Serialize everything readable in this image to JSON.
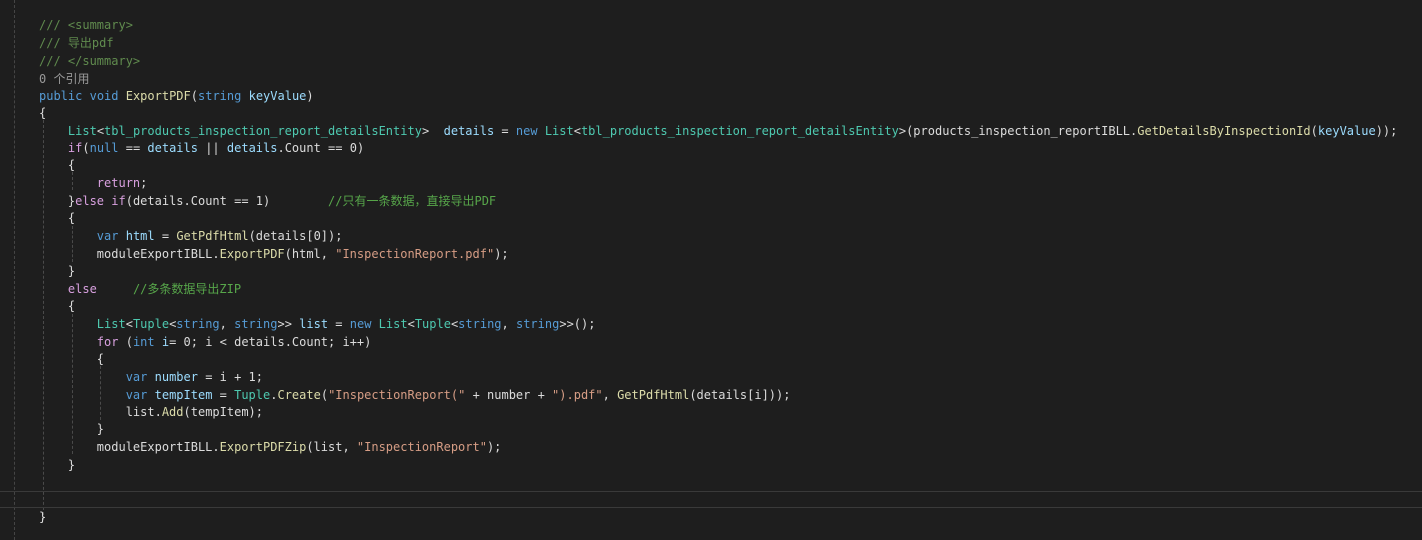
{
  "editor": {
    "colors": {
      "background": "#1e1e1e",
      "text": "#dcdcdc",
      "comment": "#57a64a",
      "keyword": "#569cd6",
      "control_keyword": "#d8a0df",
      "type": "#4ec9b0",
      "method": "#dcdcaa",
      "variable": "#9cdcfe",
      "string": "#d69d85"
    },
    "lines": [
      {
        "tokens": [
          {
            "t": "/// <summary>",
            "c": "d"
          }
        ]
      },
      {
        "tokens": [
          {
            "t": "/// 导出pdf",
            "c": "d"
          }
        ]
      },
      {
        "tokens": [
          {
            "t": "/// </summary>",
            "c": "d"
          }
        ]
      },
      {
        "tokens": [
          {
            "t": "0 个引用",
            "c": "g"
          }
        ]
      },
      {
        "tokens": [
          {
            "t": "public",
            "c": "k"
          },
          {
            "t": " "
          },
          {
            "t": "void",
            "c": "k"
          },
          {
            "t": " "
          },
          {
            "t": "ExportPDF",
            "c": "m"
          },
          {
            "t": "("
          },
          {
            "t": "string",
            "c": "k"
          },
          {
            "t": " "
          },
          {
            "t": "keyValue",
            "c": "v"
          },
          {
            "t": ")"
          }
        ]
      },
      {
        "tokens": [
          {
            "t": "{"
          }
        ]
      },
      {
        "tokens": [
          {
            "t": "    "
          },
          {
            "t": "List",
            "c": "t"
          },
          {
            "t": "<"
          },
          {
            "t": "tbl_products_inspection_report_detailsEntity",
            "c": "t"
          },
          {
            "t": ">  "
          },
          {
            "t": "details",
            "c": "v"
          },
          {
            "t": " = "
          },
          {
            "t": "new",
            "c": "k"
          },
          {
            "t": " "
          },
          {
            "t": "List",
            "c": "t"
          },
          {
            "t": "<"
          },
          {
            "t": "tbl_products_inspection_report_detailsEntity",
            "c": "t"
          },
          {
            "t": ">(products_inspection_reportIBLL."
          },
          {
            "t": "GetDetailsByInspectionId",
            "c": "m"
          },
          {
            "t": "("
          },
          {
            "t": "keyValue",
            "c": "v"
          },
          {
            "t": "));"
          }
        ]
      },
      {
        "tokens": [
          {
            "t": "    "
          },
          {
            "t": "if",
            "c": "k2"
          },
          {
            "t": "("
          },
          {
            "t": "null",
            "c": "k"
          },
          {
            "t": " == "
          },
          {
            "t": "details",
            "c": "v"
          },
          {
            "t": " || "
          },
          {
            "t": "details",
            "c": "v"
          },
          {
            "t": ".Count == 0)"
          }
        ]
      },
      {
        "tokens": [
          {
            "t": "    {"
          }
        ]
      },
      {
        "tokens": [
          {
            "t": "        "
          },
          {
            "t": "return",
            "c": "k2"
          },
          {
            "t": ";"
          }
        ]
      },
      {
        "tokens": [
          {
            "t": "    }"
          },
          {
            "t": "else",
            "c": "k2"
          },
          {
            "t": " "
          },
          {
            "t": "if",
            "c": "k2"
          },
          {
            "t": "(details.Count == 1)        "
          },
          {
            "t": "//只有一条数据，直接导出PDF",
            "c": "c"
          }
        ]
      },
      {
        "tokens": [
          {
            "t": "    {"
          }
        ]
      },
      {
        "tokens": [
          {
            "t": "        "
          },
          {
            "t": "var",
            "c": "k"
          },
          {
            "t": " "
          },
          {
            "t": "html",
            "c": "v"
          },
          {
            "t": " = "
          },
          {
            "t": "GetPdfHtml",
            "c": "m"
          },
          {
            "t": "(details[0]);"
          }
        ]
      },
      {
        "tokens": [
          {
            "t": "        moduleExportIBLL."
          },
          {
            "t": "ExportPDF",
            "c": "m"
          },
          {
            "t": "(html, "
          },
          {
            "t": "\"InspectionReport.pdf\"",
            "c": "s"
          },
          {
            "t": ");"
          }
        ]
      },
      {
        "tokens": [
          {
            "t": "    }"
          }
        ]
      },
      {
        "tokens": [
          {
            "t": "    "
          },
          {
            "t": "else",
            "c": "k2"
          },
          {
            "t": "     "
          },
          {
            "t": "//多条数据导出ZIP",
            "c": "c"
          }
        ]
      },
      {
        "tokens": [
          {
            "t": "    {"
          }
        ]
      },
      {
        "tokens": [
          {
            "t": "        "
          },
          {
            "t": "List",
            "c": "t"
          },
          {
            "t": "<"
          },
          {
            "t": "Tuple",
            "c": "t"
          },
          {
            "t": "<"
          },
          {
            "t": "string",
            "c": "k"
          },
          {
            "t": ", "
          },
          {
            "t": "string",
            "c": "k"
          },
          {
            "t": ">> "
          },
          {
            "t": "list",
            "c": "v"
          },
          {
            "t": " = "
          },
          {
            "t": "new",
            "c": "k"
          },
          {
            "t": " "
          },
          {
            "t": "List",
            "c": "t"
          },
          {
            "t": "<"
          },
          {
            "t": "Tuple",
            "c": "t"
          },
          {
            "t": "<"
          },
          {
            "t": "string",
            "c": "k"
          },
          {
            "t": ", "
          },
          {
            "t": "string",
            "c": "k"
          },
          {
            "t": ">>();"
          }
        ]
      },
      {
        "tokens": [
          {
            "t": "        "
          },
          {
            "t": "for",
            "c": "k2"
          },
          {
            "t": " ("
          },
          {
            "t": "int",
            "c": "k"
          },
          {
            "t": " "
          },
          {
            "t": "i",
            "c": "v"
          },
          {
            "t": "= 0; i < details.Count; i++)"
          }
        ]
      },
      {
        "tokens": [
          {
            "t": "        {"
          }
        ]
      },
      {
        "tokens": [
          {
            "t": "            "
          },
          {
            "t": "var",
            "c": "k"
          },
          {
            "t": " "
          },
          {
            "t": "number",
            "c": "v"
          },
          {
            "t": " = i + 1;"
          }
        ]
      },
      {
        "tokens": [
          {
            "t": "            "
          },
          {
            "t": "var",
            "c": "k"
          },
          {
            "t": " "
          },
          {
            "t": "tempItem",
            "c": "v"
          },
          {
            "t": " = "
          },
          {
            "t": "Tuple",
            "c": "t"
          },
          {
            "t": "."
          },
          {
            "t": "Create",
            "c": "m"
          },
          {
            "t": "("
          },
          {
            "t": "\"InspectionReport(\"",
            "c": "s"
          },
          {
            "t": " + number + "
          },
          {
            "t": "\").pdf\"",
            "c": "s"
          },
          {
            "t": ", "
          },
          {
            "t": "GetPdfHtml",
            "c": "m"
          },
          {
            "t": "(details[i]));"
          }
        ]
      },
      {
        "tokens": [
          {
            "t": "            list."
          },
          {
            "t": "Add",
            "c": "m"
          },
          {
            "t": "(tempItem);"
          }
        ]
      },
      {
        "tokens": [
          {
            "t": "        }"
          }
        ]
      },
      {
        "tokens": [
          {
            "t": "        moduleExportIBLL."
          },
          {
            "t": "ExportPDFZip",
            "c": "m"
          },
          {
            "t": "(list, "
          },
          {
            "t": "\"InspectionReport\"",
            "c": "s"
          },
          {
            "t": ");"
          }
        ]
      },
      {
        "tokens": [
          {
            "t": "    }"
          }
        ]
      },
      {
        "tokens": []
      },
      {
        "tokens": []
      },
      {
        "tokens": [
          {
            "t": "}"
          }
        ]
      }
    ]
  }
}
